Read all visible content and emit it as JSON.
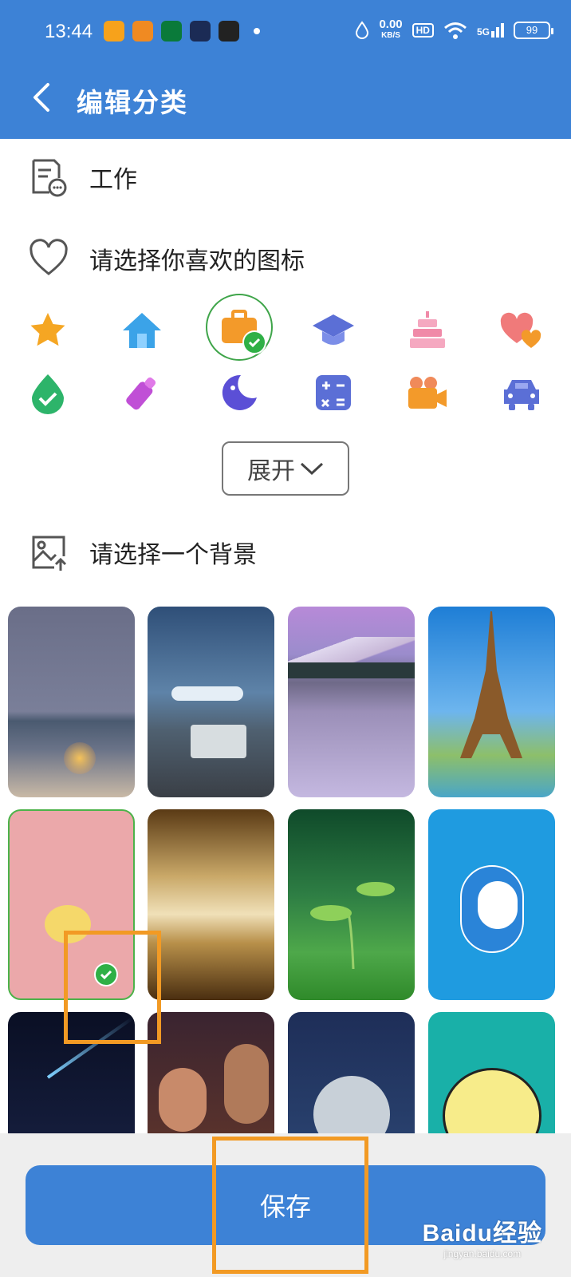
{
  "status_bar": {
    "time": "13:44",
    "net_speed": "0.00",
    "net_unit": "KB/S",
    "hd": "HD",
    "signal": "5G",
    "battery": "99"
  },
  "header": {
    "title": "编辑分类"
  },
  "category": {
    "name": "工作"
  },
  "icon_section": {
    "label": "请选择你喜欢的图标"
  },
  "icons": [
    {
      "name": "star",
      "color": "#f5a623",
      "selected": false
    },
    {
      "name": "house",
      "color": "#3ba3e8",
      "selected": false
    },
    {
      "name": "briefcase",
      "color": "#f39a2a",
      "selected": true
    },
    {
      "name": "graduation-cap",
      "color": "#5b6fd6",
      "selected": false
    },
    {
      "name": "cake",
      "color": "#f08aa8",
      "selected": false
    },
    {
      "name": "hearts",
      "color": "#f07a7a",
      "selected": false
    },
    {
      "name": "water-drop-check",
      "color": "#2db46a",
      "selected": false
    },
    {
      "name": "baby-bottle",
      "color": "#c04fd6",
      "selected": false
    },
    {
      "name": "moon",
      "color": "#5b4fd6",
      "selected": false
    },
    {
      "name": "calculator",
      "color": "#5b6fd6",
      "selected": false
    },
    {
      "name": "video-camera",
      "color": "#f39a2a",
      "selected": false
    },
    {
      "name": "car",
      "color": "#5b6fd6",
      "selected": false
    }
  ],
  "expand_button": {
    "label": "展开"
  },
  "background_section": {
    "label": "请选择一个背景"
  },
  "backgrounds": [
    {
      "name": "beach-night",
      "selected": false
    },
    {
      "name": "street-bus",
      "selected": false
    },
    {
      "name": "snow-mountain",
      "selected": false
    },
    {
      "name": "eiffel-tower",
      "selected": false
    },
    {
      "name": "pink-chick",
      "selected": true
    },
    {
      "name": "gold-waves",
      "selected": false
    },
    {
      "name": "green-sprout",
      "selected": false
    },
    {
      "name": "doraemon",
      "selected": false
    },
    {
      "name": "shooting-star",
      "selected": false
    },
    {
      "name": "couple",
      "selected": false
    },
    {
      "name": "moon-night",
      "selected": false
    },
    {
      "name": "yellow-cartoon",
      "selected": false
    }
  ],
  "save_button": {
    "label": "保存"
  },
  "watermark": {
    "main": "Baidu经验",
    "sub": "jingyan.baidu.com"
  },
  "colors": {
    "primary": "#3d82d6",
    "accent_check": "#2fb046",
    "annotation": "#f29a24"
  }
}
